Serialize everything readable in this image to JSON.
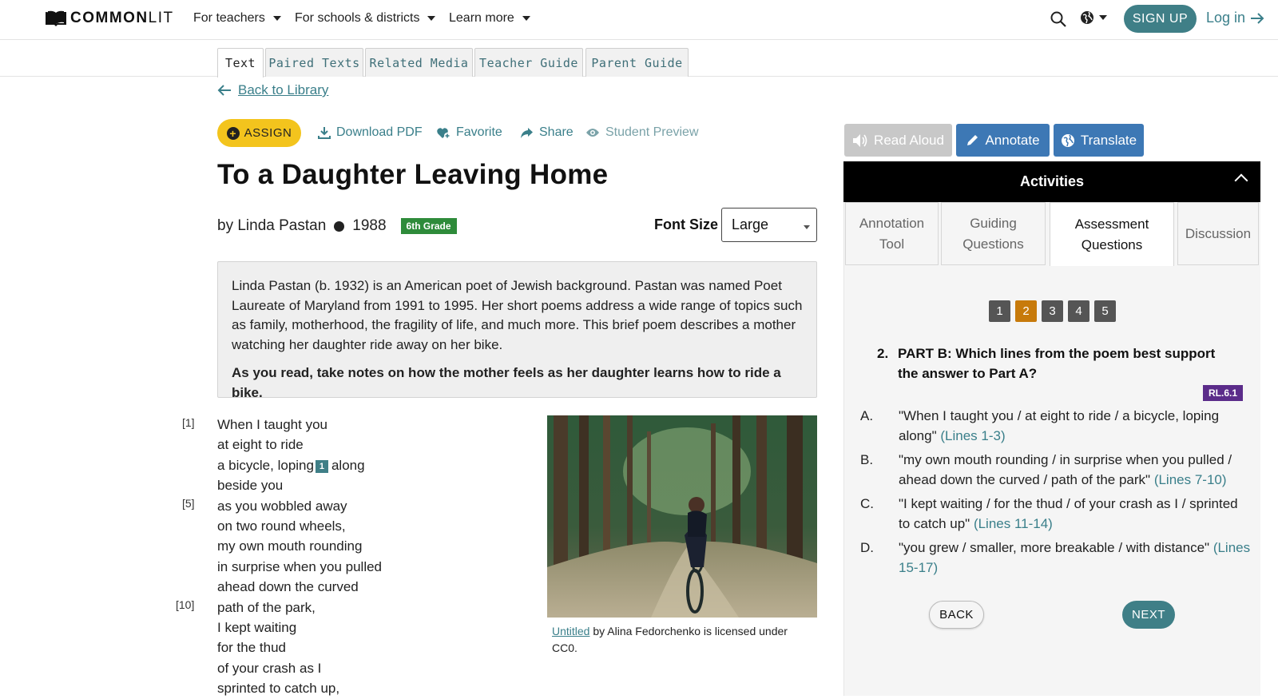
{
  "nav": {
    "logo_bold": "COMMON",
    "logo_light": "LIT",
    "items": [
      "For teachers",
      "For schools & districts",
      "Learn more"
    ],
    "signup": "SIGN UP",
    "login": "Log in",
    "accent": "#3f7f87"
  },
  "tabs": [
    "Text",
    "Paired Texts",
    "Related Media",
    "Teacher Guide",
    "Parent Guide"
  ],
  "back_link": "Back to Library",
  "actions": {
    "assign": "ASSIGN",
    "download": "Download PDF",
    "favorite": "Favorite",
    "share": "Share",
    "preview": "Student Preview"
  },
  "text": {
    "title": "To a Daughter Leaving Home",
    "author": "by Linda Pastan",
    "year": "1988",
    "grade": "6th Grade",
    "font_size_label": "Font Size",
    "font_size_value": "Large",
    "intro": "Linda Pastan (b. 1932) is an American poet of Jewish background. Pastan was named Poet Laureate of Maryland from 1991 to 1995. Her short poems address a wide range of topics such as family, motherhood, the fragility of life, and much more. This brief poem describes a mother watching her daughter ride away on her bike.",
    "intro_bold": "As you read, take notes on how the mother feels as her daughter learns how to ride a bike.",
    "line_markers": [
      "[1]",
      "[5]",
      "[10]"
    ],
    "poem": {
      "l1": "When I taught you",
      "l2": "at eight to ride",
      "l3a": "a bicycle, loping",
      "footnote": "1",
      "l3b": "along",
      "l4": "beside you",
      "l5": "as you wobbled away",
      "l6": "on two round wheels,",
      "l7": "my own mouth rounding",
      "l8": "in surprise when you pulled",
      "l9": "ahead down the curved",
      "l10": "path of the park,",
      "l11": "I kept waiting",
      "l12": "for the thud",
      "l13": "of your crash as I",
      "l14": "sprinted to catch up,"
    },
    "caption_link": "Untitled",
    "caption_rest": " by Alina Fedorchenko is licensed under CC0."
  },
  "tools": {
    "read_aloud": "Read Aloud",
    "annotate": "Annotate",
    "translate": "Translate"
  },
  "activities": {
    "header": "Activities",
    "tabs": [
      "Annotation Tool",
      "Guiding Questions",
      "Assessment Questions",
      "Discussion"
    ],
    "active_tab": "Assessment Questions"
  },
  "question": {
    "numbers": [
      "1",
      "2",
      "3",
      "4",
      "5"
    ],
    "current": "2",
    "number_label": "2.",
    "prompt": "PART B: Which lines from the poem best support the answer to Part A?",
    "standard": "RL.6.1",
    "options": [
      {
        "letter": "A.",
        "text": "\"When I taught you / at eight to ride / a bicycle, loping along\" ",
        "lines": "(Lines 1-3)"
      },
      {
        "letter": "B.",
        "text": "\"my own mouth rounding / in surprise when you pulled / ahead down the curved / path of the park\" ",
        "lines": "(Lines 7-10)"
      },
      {
        "letter": "C.",
        "text": "\"I kept waiting / for the thud / of your crash as I / sprinted to catch up\" ",
        "lines": "(Lines 11-14)"
      },
      {
        "letter": "D.",
        "text": "\"you grew / smaller, more breakable / with distance\" ",
        "lines": "(Lines 15-17)"
      }
    ],
    "back": "BACK",
    "next": "NEXT"
  }
}
